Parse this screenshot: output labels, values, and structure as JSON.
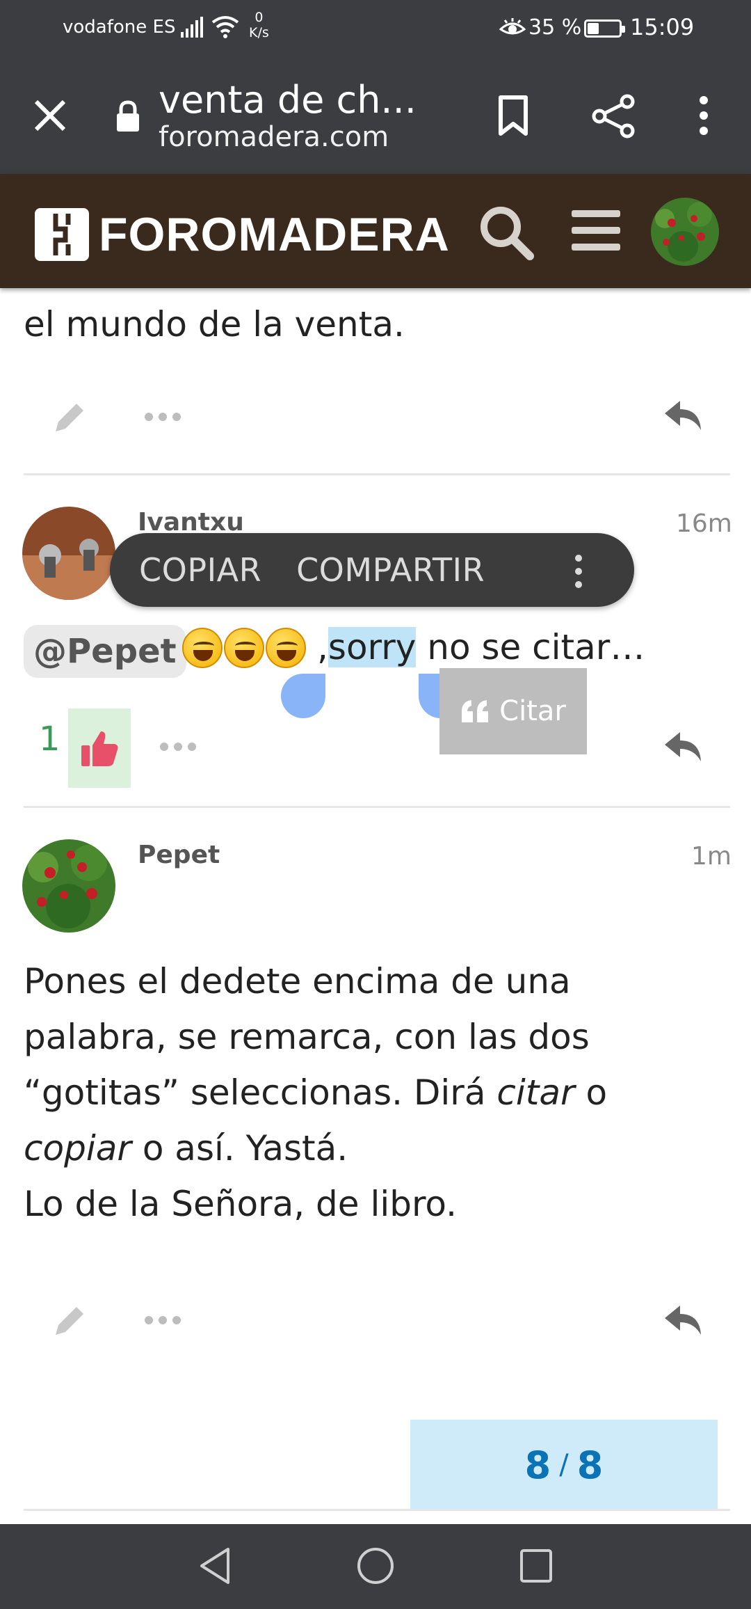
{
  "status_bar": {
    "carrier": "vodafone ES",
    "net_speed_value": "0",
    "net_speed_unit": "K/s",
    "battery": "35 %",
    "time": "15:09"
  },
  "browser": {
    "page_title": "venta de ch...",
    "domain": "foromadera.com"
  },
  "site": {
    "logo_text": "FOROMADERA"
  },
  "posts": [
    {
      "text": "el mundo de la venta."
    },
    {
      "author": "Ivantxu",
      "time": "16m",
      "mention": "@Pepet",
      "text_before": ",",
      "selected": "sorry",
      "text_after": " no se citar…",
      "likes": "1"
    },
    {
      "author": "Pepet",
      "time": "1m",
      "line1": "Pones el dedete encima de una",
      "line2": "palabra, se remarca, con las dos",
      "line3_a": "“gotitas” seleccionas. Dirá ",
      "line3_em": "citar",
      "line3_b": " o",
      "line4_em": "copiar",
      "line4_b": " o así. Yastá.",
      "line5": "Lo de la Señora, de libro."
    }
  ],
  "context_menu": {
    "copy": "COPIAR",
    "share": "COMPARTIR"
  },
  "quote_button": {
    "label": "Citar"
  },
  "progress": {
    "current": "8",
    "total": "8"
  },
  "icons": [
    "close-icon",
    "lock-icon",
    "bookmark-icon",
    "share-icon",
    "more-vert-icon",
    "search-icon",
    "hamburger-icon",
    "pencil-icon",
    "ellipsis-icon",
    "reply-icon",
    "thumbs-up-icon",
    "quote-icon",
    "back-icon",
    "home-icon",
    "recents-icon"
  ],
  "colors": {
    "header_bg": "#3a2a1e",
    "toolbar_bg": "#3b3d40",
    "selection": "#bfe4f7",
    "like_green": "#3a9a5a",
    "progress_bg": "#cfebf9",
    "progress_text": "#0a73b6"
  }
}
